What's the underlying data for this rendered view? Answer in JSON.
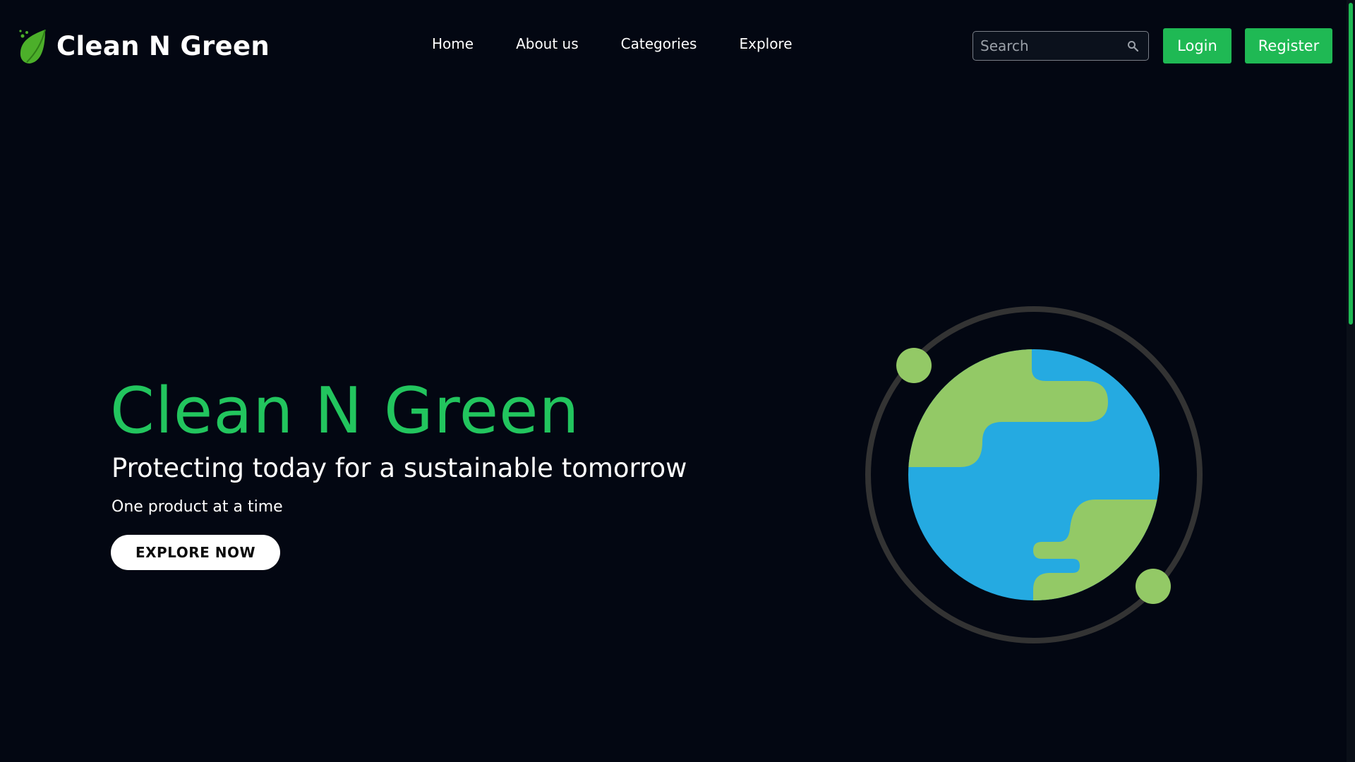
{
  "brand": {
    "name": "Clean N Green",
    "logo_icon": "leaf-icon"
  },
  "nav": {
    "links": [
      {
        "label": "Home"
      },
      {
        "label": "About us"
      },
      {
        "label": "Categories"
      },
      {
        "label": "Explore"
      }
    ]
  },
  "search": {
    "placeholder": "Search",
    "value": "",
    "icon": "search-icon"
  },
  "auth": {
    "login_label": "Login",
    "register_label": "Register"
  },
  "hero": {
    "title": "Clean N Green",
    "subtitle": "Protecting today for a sustainable tomorrow",
    "tagline": "One product at a time",
    "cta_label": "EXPLORE NOW",
    "illustration_icon": "earth-icon"
  },
  "colors": {
    "background": "#030712",
    "accent": "#22c55e",
    "button": "#1fb954",
    "land": "#93c966",
    "ocean": "#25aae1",
    "orbit": "#333333"
  }
}
